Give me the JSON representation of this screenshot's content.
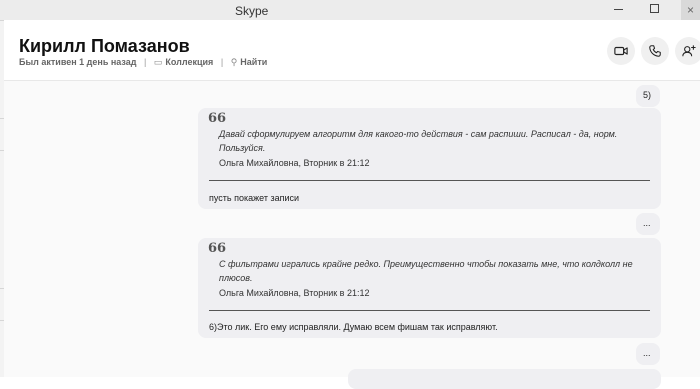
{
  "window": {
    "title": "Skype",
    "close_glyph": "×"
  },
  "header": {
    "name": "Кирилл Помазанов",
    "status": "Был активен 1 день назад",
    "separator": "|",
    "collection_label": "Коллекция",
    "find_label": "Найти",
    "icons": [
      "video-call-icon",
      "audio-call-icon",
      "add-people-icon"
    ]
  },
  "messages": [
    {
      "text": "5)"
    },
    {
      "quote_mark": "66",
      "quote_text": "Давай сформулируем алгоритм для какого-то действия - сам распиши. Расписал - да, норм. Пользуйся.",
      "quote_author": "Ольга Михайловна, Вторник в 21:12",
      "reply": "пусть покажет записи"
    },
    {
      "text": "..."
    },
    {
      "quote_mark": "66",
      "quote_text": " С фильтрами игрались крайне редко. Преимущественно чтобы показать мне, что колдколл не плюсов.",
      "quote_author": "Ольга Михайловна, Вторник в 21:12",
      "reply": "6)Это лик. Его ему исправляли. Думаю всем фишам так исправляют."
    },
    {
      "text": "..."
    }
  ],
  "colors": {
    "bubble": "#efeff2",
    "header_bg": "#ffffff",
    "chat_bg": "#fafafa"
  }
}
